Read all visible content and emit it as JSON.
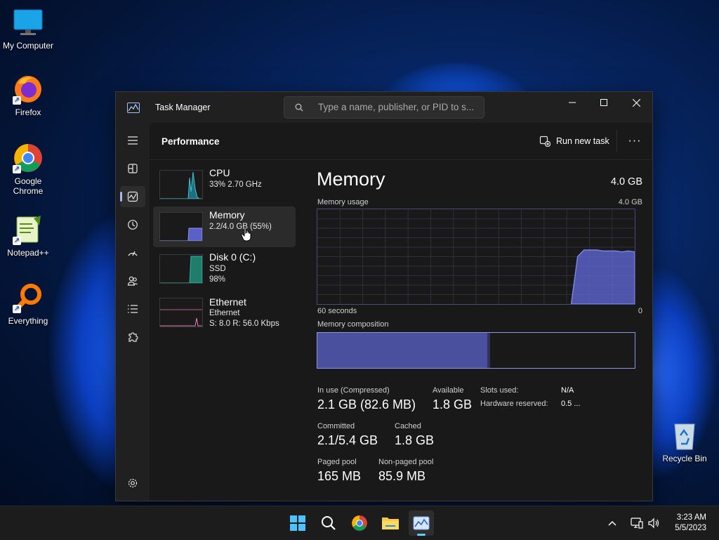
{
  "desktop": {
    "icons": [
      {
        "label": "My Computer"
      },
      {
        "label": "Firefox"
      },
      {
        "label": "Google Chrome"
      },
      {
        "label": "Notepad++"
      },
      {
        "label": "Everything"
      },
      {
        "label": "Recycle Bin"
      }
    ]
  },
  "window": {
    "title": "Task Manager",
    "search_placeholder": "Type a name, publisher, or PID to s...",
    "page_title": "Performance",
    "run_new_task": "Run new task",
    "more": "···"
  },
  "perf_items": [
    {
      "name": "CPU",
      "line1": "33%  2.70 GHz",
      "line2": ""
    },
    {
      "name": "Memory",
      "line1": "2.2/4.0 GB (55%)",
      "line2": ""
    },
    {
      "name": "Disk 0 (C:)",
      "line1": "SSD",
      "line2": "98%"
    },
    {
      "name": "Ethernet",
      "line1": "Ethernet",
      "line2": "S: 8.0  R: 56.0 Kbps"
    }
  ],
  "memory": {
    "title": "Memory",
    "total": "4.0 GB",
    "usage_label": "Memory usage",
    "usage_max": "4.0 GB",
    "time_left": "60 seconds",
    "time_right": "0",
    "composition_label": "Memory composition",
    "composition_in_use_fraction": 0.535,
    "usage_history_fraction": [
      0,
      0,
      0,
      0,
      0,
      0,
      0,
      0,
      0,
      0,
      0,
      0,
      0,
      0,
      0,
      0,
      0,
      0,
      0,
      0,
      0,
      0,
      0,
      0,
      0,
      0,
      0,
      0,
      0,
      0,
      0,
      0,
      0,
      0,
      0,
      0,
      0,
      0,
      0,
      0,
      0,
      0.5,
      0.57,
      0.57,
      0.57,
      0.56,
      0.56,
      0.56,
      0.55,
      0.56,
      0.55
    ],
    "stats": {
      "in_use_label": "In use (Compressed)",
      "in_use_value": "2.1 GB (82.6 MB)",
      "available_label": "Available",
      "available_value": "1.8 GB",
      "slots_label": "Slots used:",
      "slots_value": "N/A",
      "hw_reserved_label": "Hardware reserved:",
      "hw_reserved_value": "0.5 ...",
      "committed_label": "Committed",
      "committed_value": "2.1/5.4 GB",
      "cached_label": "Cached",
      "cached_value": "1.8 GB",
      "paged_label": "Paged pool",
      "paged_value": "165 MB",
      "nonpaged_label": "Non-paged pool",
      "nonpaged_value": "85.9 MB"
    }
  },
  "taskbar": {
    "time": "3:23 AM",
    "date": "5/5/2023"
  },
  "colors": {
    "accent_memory": "#7b83e0",
    "accent_cpu": "#3fc1d6",
    "accent_disk": "#2fb3a0",
    "accent_ethernet": "#e77ab4"
  }
}
